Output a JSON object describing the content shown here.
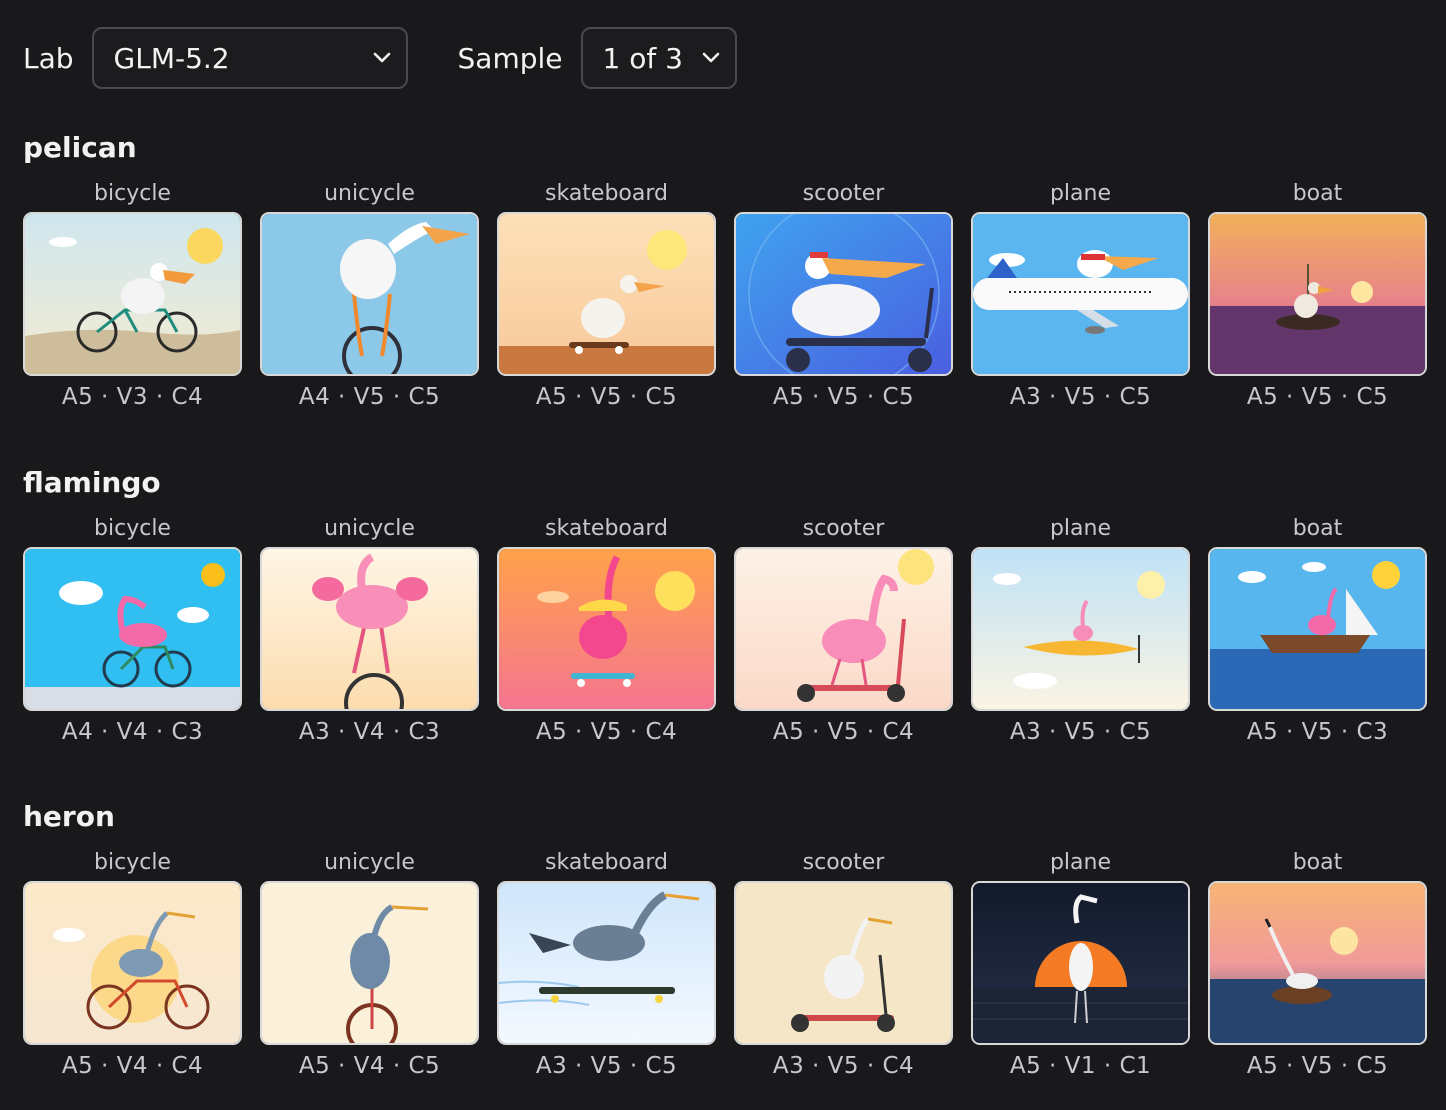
{
  "toolbar": {
    "lab_label": "Lab",
    "lab_value": "GLM-5.2",
    "sample_label": "Sample",
    "sample_value": "1 of 3"
  },
  "sections": [
    {
      "title": "pelican",
      "items": [
        {
          "vehicle": "bicycle",
          "score": "A5 · V3 · C4"
        },
        {
          "vehicle": "unicycle",
          "score": "A4 · V5 · C5"
        },
        {
          "vehicle": "skateboard",
          "score": "A5 · V5 · C5"
        },
        {
          "vehicle": "scooter",
          "score": "A5 · V5 · C5"
        },
        {
          "vehicle": "plane",
          "score": "A3 · V5 · C5"
        },
        {
          "vehicle": "boat",
          "score": "A5 · V5 · C5"
        }
      ]
    },
    {
      "title": "flamingo",
      "items": [
        {
          "vehicle": "bicycle",
          "score": "A4 · V4 · C3"
        },
        {
          "vehicle": "unicycle",
          "score": "A3 · V4 · C3"
        },
        {
          "vehicle": "skateboard",
          "score": "A5 · V5 · C4"
        },
        {
          "vehicle": "scooter",
          "score": "A5 · V5 · C4"
        },
        {
          "vehicle": "plane",
          "score": "A3 · V5 · C5"
        },
        {
          "vehicle": "boat",
          "score": "A5 · V5 · C3"
        }
      ]
    },
    {
      "title": "heron",
      "items": [
        {
          "vehicle": "bicycle",
          "score": "A5 · V4 · C4"
        },
        {
          "vehicle": "unicycle",
          "score": "A5 · V4 · C5"
        },
        {
          "vehicle": "skateboard",
          "score": "A3 · V5 · C5"
        },
        {
          "vehicle": "scooter",
          "score": "A3 · V5 · C4"
        },
        {
          "vehicle": "plane",
          "score": "A5 · V1 · C1"
        },
        {
          "vehicle": "boat",
          "score": "A5 · V5 · C5"
        }
      ]
    }
  ]
}
